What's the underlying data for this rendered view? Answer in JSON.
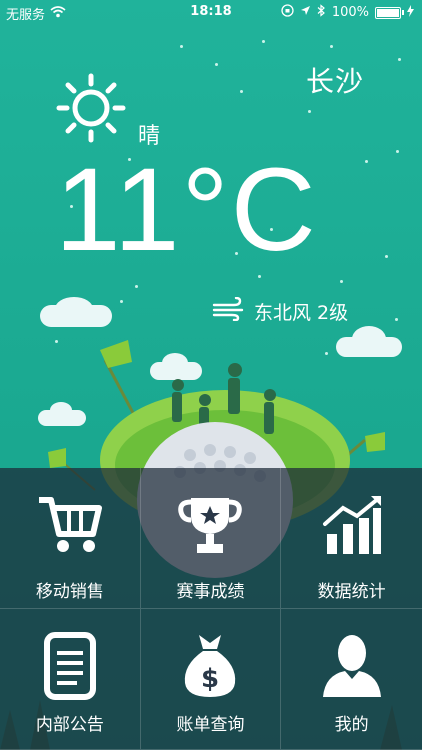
{
  "status_bar": {
    "carrier": "无服务",
    "time": "18:18",
    "battery": "100%",
    "icons": [
      "wifi-icon",
      "orientation-lock-icon",
      "location-icon",
      "bluetooth-icon",
      "battery-icon",
      "charging-icon"
    ]
  },
  "weather": {
    "city": "长沙",
    "condition": "晴",
    "temperature": "11°C",
    "wind": "东北风 2级",
    "icons": [
      "sun-icon",
      "wind-icon"
    ]
  },
  "menu": {
    "items": [
      {
        "label": "移动销售",
        "icon": "cart-icon"
      },
      {
        "label": "赛事成绩",
        "icon": "trophy-icon"
      },
      {
        "label": "数据统计",
        "icon": "chart-icon"
      },
      {
        "label": "内部公告",
        "icon": "document-icon"
      },
      {
        "label": "账单查询",
        "icon": "money-bag-icon"
      },
      {
        "label": "我的",
        "icon": "user-icon"
      }
    ]
  },
  "colors": {
    "background": "#1fb199",
    "tile_overlay": "#1c2837",
    "golf_ball": "#dfe4ea",
    "grass": "#7fc44a"
  }
}
